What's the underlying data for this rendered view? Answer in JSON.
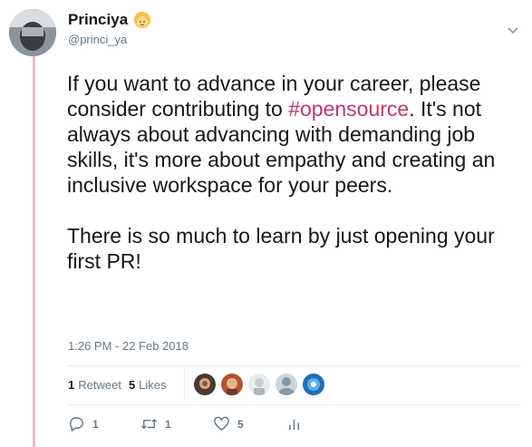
{
  "author": {
    "name": "Princiya",
    "handle": "@princi_ya",
    "name_emoji": "woman-emoji-icon"
  },
  "tweet": {
    "text_before": "If you want to advance in your career, please consider contributing to ",
    "hashtag": "#opensource",
    "text_after": ". It's not always about advancing with demanding job skills, it's more about empathy and creating an inclusive workspace for your peers.\n\nThere is so much to learn by just opening your first PR!",
    "timestamp": "1:26 PM - 22 Feb 2018"
  },
  "stats": {
    "retweets_count": "1",
    "retweets_label": "Retweet",
    "likes_count": "5",
    "likes_label": "Likes"
  },
  "actions": {
    "reply_count": "1",
    "retweet_count": "1",
    "like_count": "5"
  },
  "colors": {
    "hashtag": "#c23671",
    "thread_line": "#f2b8cc",
    "secondary_text": "#657786"
  }
}
